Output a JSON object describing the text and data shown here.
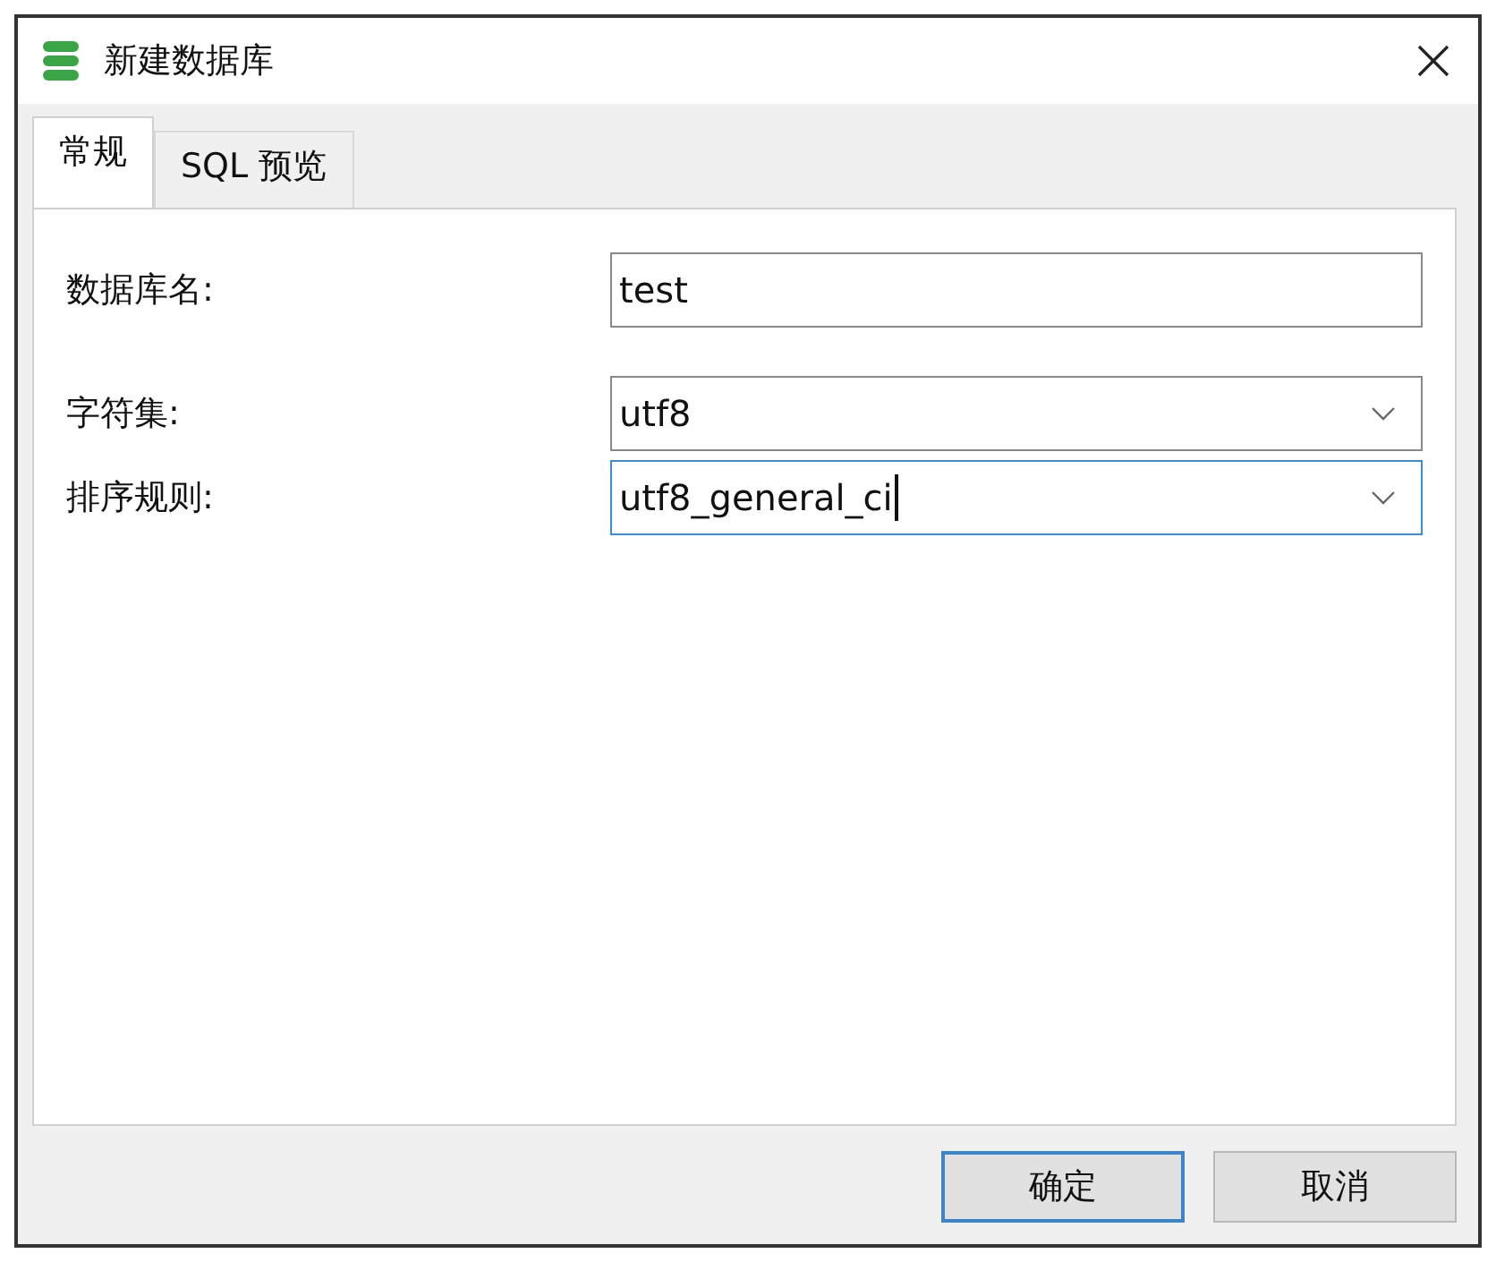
{
  "window": {
    "title": "新建数据库"
  },
  "tabs": [
    {
      "label": "常规",
      "selected": true
    },
    {
      "label": "SQL 预览",
      "selected": false
    }
  ],
  "fields": [
    {
      "kind": "text",
      "label": "数据库名:",
      "value": "test",
      "focused": false
    },
    {
      "kind": "select",
      "label": "字符集:",
      "value": "utf8",
      "focused": false
    },
    {
      "kind": "select",
      "label": "排序规则:",
      "value": "utf8_general_ci",
      "focused": true
    }
  ],
  "buttons": [
    {
      "label": "确定",
      "default": true
    },
    {
      "label": "取消",
      "default": false
    }
  ]
}
